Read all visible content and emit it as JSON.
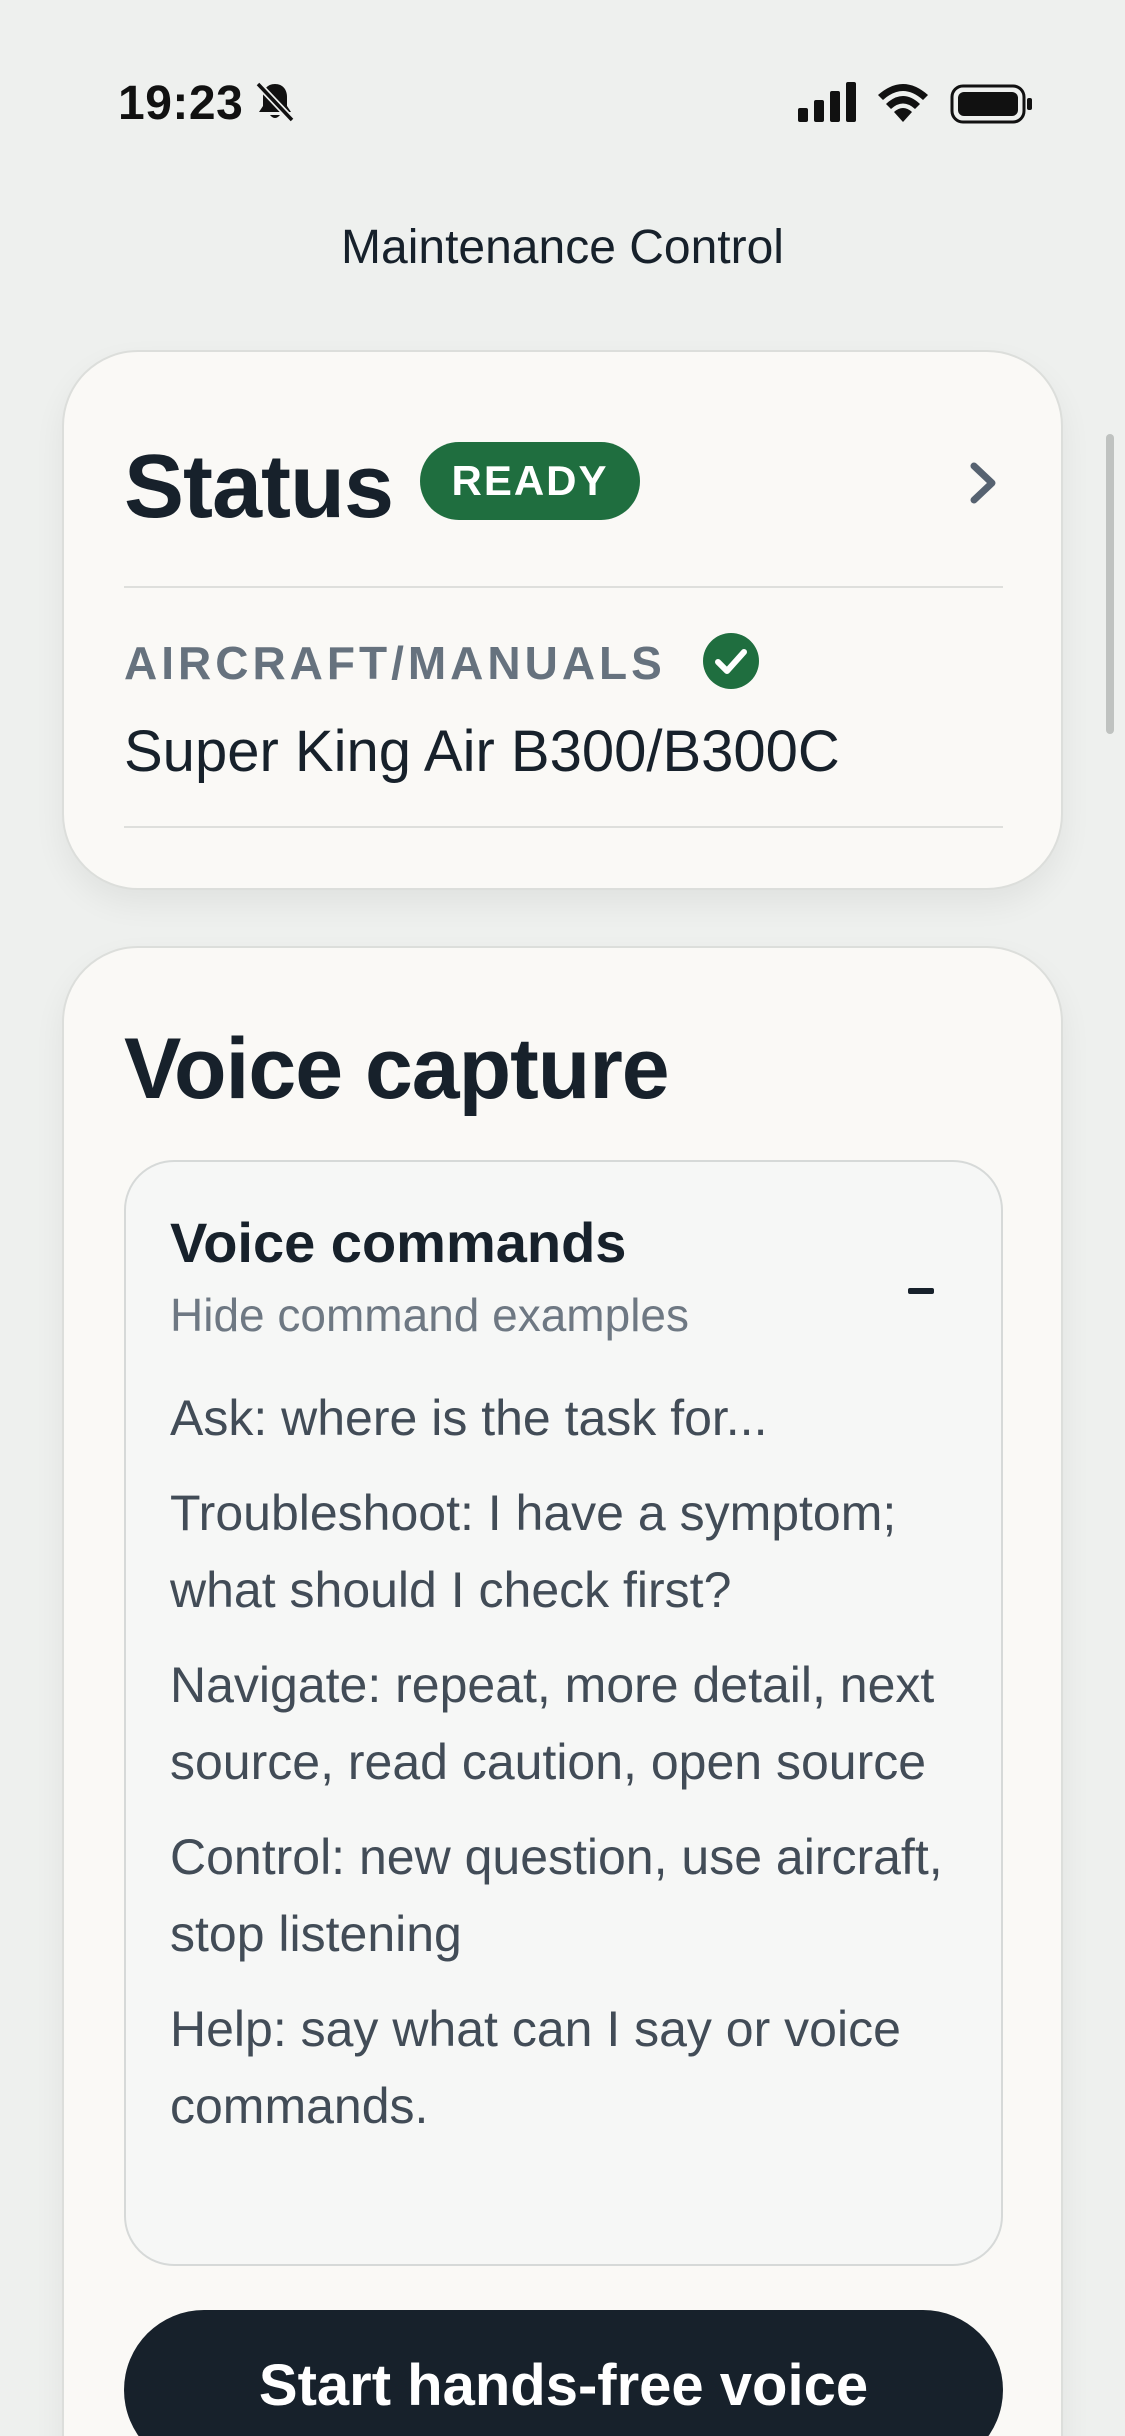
{
  "status_bar": {
    "time": "19:23",
    "icons": [
      "bell-slash-icon",
      "cellular-signal-icon",
      "wifi-icon",
      "battery-icon"
    ]
  },
  "header": {
    "title": "Maintenance Control"
  },
  "status_card": {
    "title": "Status",
    "badge": "READY",
    "badge_color": "#1f6e3f",
    "aircraft_label": "AIRCRAFT/MANUALS",
    "aircraft_value": "Super King Air B300/B300C",
    "check_color": "#1f6e3f"
  },
  "voice_card": {
    "title": "Voice capture",
    "commands": {
      "heading": "Voice commands",
      "toggle_label": "Hide command examples",
      "items": [
        "Ask: where is the task for...",
        "Troubleshoot: I have a symptom; what should I check first?",
        "Navigate: repeat, more detail, next source, read caution, open source",
        "Control: new question, use aircraft, stop listening",
        "Help: say what can I say or voice commands."
      ]
    },
    "start_button": "Start hands-free voice"
  },
  "colors": {
    "background": "#eef0ee",
    "card": "#faf9f6",
    "primary_dark": "#17212b",
    "muted": "#66727e"
  }
}
